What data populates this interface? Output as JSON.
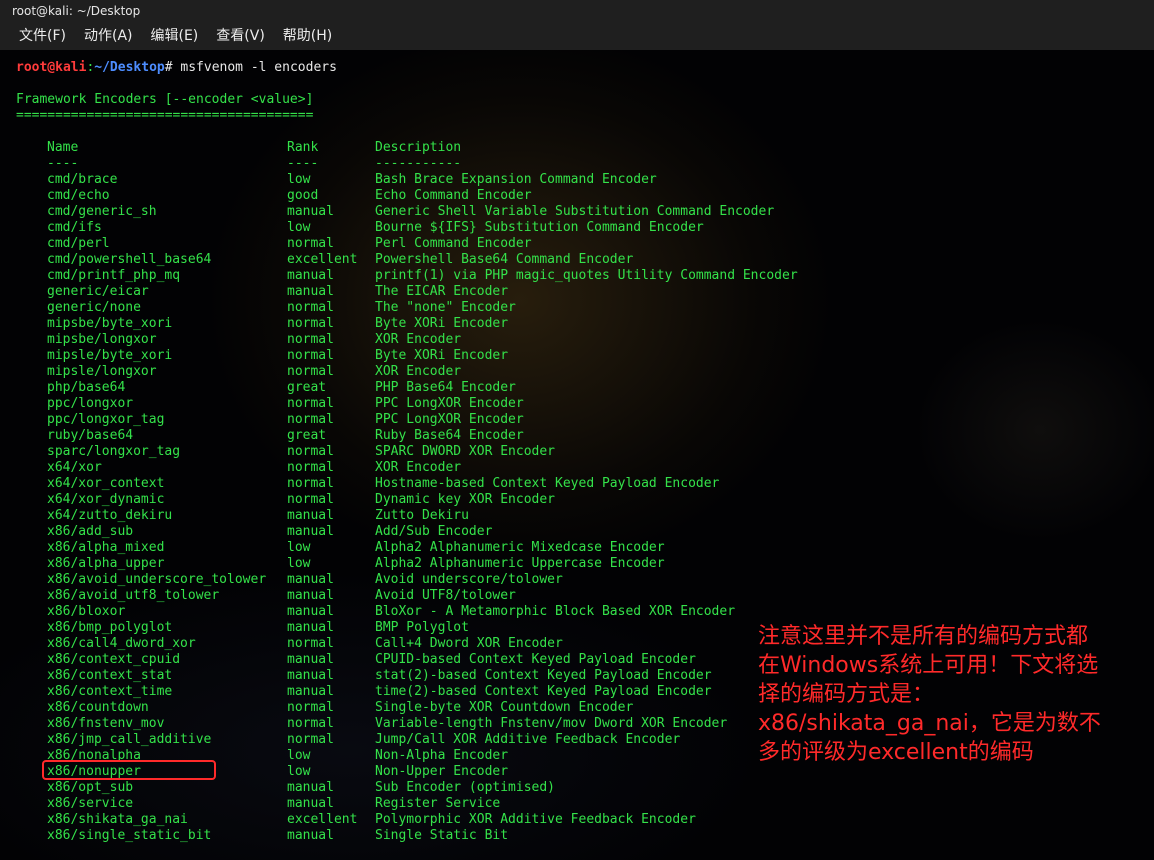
{
  "window": {
    "title": "root@kali: ~/Desktop"
  },
  "menu": [
    {
      "label": "文件(F)"
    },
    {
      "label": "动作(A)"
    },
    {
      "label": "编辑(E)"
    },
    {
      "label": "查看(V)"
    },
    {
      "label": "帮助(H)"
    }
  ],
  "prompt": {
    "user": "root@kali",
    "sep": ":",
    "path": "~/Desktop",
    "sym": "# ",
    "command": "msfvenom -l encoders"
  },
  "section": {
    "title": "Framework Encoders [--encoder <value>]",
    "underline": "======================================"
  },
  "headers": {
    "name": "Name",
    "rank": "Rank",
    "desc": "Description"
  },
  "header_underline": {
    "name": "----",
    "rank": "----",
    "desc": "-----------"
  },
  "encoders": [
    {
      "name": "cmd/brace",
      "rank": "low",
      "desc": "Bash Brace Expansion Command Encoder"
    },
    {
      "name": "cmd/echo",
      "rank": "good",
      "desc": "Echo Command Encoder"
    },
    {
      "name": "cmd/generic_sh",
      "rank": "manual",
      "desc": "Generic Shell Variable Substitution Command Encoder"
    },
    {
      "name": "cmd/ifs",
      "rank": "low",
      "desc": "Bourne ${IFS} Substitution Command Encoder"
    },
    {
      "name": "cmd/perl",
      "rank": "normal",
      "desc": "Perl Command Encoder"
    },
    {
      "name": "cmd/powershell_base64",
      "rank": "excellent",
      "desc": "Powershell Base64 Command Encoder"
    },
    {
      "name": "cmd/printf_php_mq",
      "rank": "manual",
      "desc": "printf(1) via PHP magic_quotes Utility Command Encoder"
    },
    {
      "name": "generic/eicar",
      "rank": "manual",
      "desc": "The EICAR Encoder"
    },
    {
      "name": "generic/none",
      "rank": "normal",
      "desc": "The \"none\" Encoder"
    },
    {
      "name": "mipsbe/byte_xori",
      "rank": "normal",
      "desc": "Byte XORi Encoder"
    },
    {
      "name": "mipsbe/longxor",
      "rank": "normal",
      "desc": "XOR Encoder"
    },
    {
      "name": "mipsle/byte_xori",
      "rank": "normal",
      "desc": "Byte XORi Encoder"
    },
    {
      "name": "mipsle/longxor",
      "rank": "normal",
      "desc": "XOR Encoder"
    },
    {
      "name": "php/base64",
      "rank": "great",
      "desc": "PHP Base64 Encoder"
    },
    {
      "name": "ppc/longxor",
      "rank": "normal",
      "desc": "PPC LongXOR Encoder"
    },
    {
      "name": "ppc/longxor_tag",
      "rank": "normal",
      "desc": "PPC LongXOR Encoder"
    },
    {
      "name": "ruby/base64",
      "rank": "great",
      "desc": "Ruby Base64 Encoder"
    },
    {
      "name": "sparc/longxor_tag",
      "rank": "normal",
      "desc": "SPARC DWORD XOR Encoder"
    },
    {
      "name": "x64/xor",
      "rank": "normal",
      "desc": "XOR Encoder"
    },
    {
      "name": "x64/xor_context",
      "rank": "normal",
      "desc": "Hostname-based Context Keyed Payload Encoder"
    },
    {
      "name": "x64/xor_dynamic",
      "rank": "normal",
      "desc": "Dynamic key XOR Encoder"
    },
    {
      "name": "x64/zutto_dekiru",
      "rank": "manual",
      "desc": "Zutto Dekiru"
    },
    {
      "name": "x86/add_sub",
      "rank": "manual",
      "desc": "Add/Sub Encoder"
    },
    {
      "name": "x86/alpha_mixed",
      "rank": "low",
      "desc": "Alpha2 Alphanumeric Mixedcase Encoder"
    },
    {
      "name": "x86/alpha_upper",
      "rank": "low",
      "desc": "Alpha2 Alphanumeric Uppercase Encoder"
    },
    {
      "name": "x86/avoid_underscore_tolower",
      "rank": "manual",
      "desc": "Avoid underscore/tolower"
    },
    {
      "name": "x86/avoid_utf8_tolower",
      "rank": "manual",
      "desc": "Avoid UTF8/tolower"
    },
    {
      "name": "x86/bloxor",
      "rank": "manual",
      "desc": "BloXor - A Metamorphic Block Based XOR Encoder"
    },
    {
      "name": "x86/bmp_polyglot",
      "rank": "manual",
      "desc": "BMP Polyglot"
    },
    {
      "name": "x86/call4_dword_xor",
      "rank": "normal",
      "desc": "Call+4 Dword XOR Encoder"
    },
    {
      "name": "x86/context_cpuid",
      "rank": "manual",
      "desc": "CPUID-based Context Keyed Payload Encoder"
    },
    {
      "name": "x86/context_stat",
      "rank": "manual",
      "desc": "stat(2)-based Context Keyed Payload Encoder"
    },
    {
      "name": "x86/context_time",
      "rank": "manual",
      "desc": "time(2)-based Context Keyed Payload Encoder"
    },
    {
      "name": "x86/countdown",
      "rank": "normal",
      "desc": "Single-byte XOR Countdown Encoder"
    },
    {
      "name": "x86/fnstenv_mov",
      "rank": "normal",
      "desc": "Variable-length Fnstenv/mov Dword XOR Encoder"
    },
    {
      "name": "x86/jmp_call_additive",
      "rank": "normal",
      "desc": "Jump/Call XOR Additive Feedback Encoder"
    },
    {
      "name": "x86/nonalpha",
      "rank": "low",
      "desc": "Non-Alpha Encoder"
    },
    {
      "name": "x86/nonupper",
      "rank": "low",
      "desc": "Non-Upper Encoder"
    },
    {
      "name": "x86/opt_sub",
      "rank": "manual",
      "desc": "Sub Encoder (optimised)"
    },
    {
      "name": "x86/service",
      "rank": "manual",
      "desc": "Register Service"
    },
    {
      "name": "x86/shikata_ga_nai",
      "rank": "excellent",
      "desc": "Polymorphic XOR Additive Feedback Encoder"
    },
    {
      "name": "x86/single_static_bit",
      "rank": "manual",
      "desc": "Single Static Bit"
    }
  ],
  "annotation": {
    "lines": [
      "注意这里并不是所有的编码方式都",
      "在Windows系统上可用！下文将选",
      "择的编码方式是：",
      "x86/shikata_ga_nai，它是为数不",
      "多的评级为excellent的编码"
    ],
    "color": "#ff2a2a"
  },
  "colors": {
    "terminal_text": "#34e24a",
    "prompt_user": "#ff3b3b",
    "prompt_path": "#4d8dff",
    "highlight": "#ff2a2a"
  }
}
